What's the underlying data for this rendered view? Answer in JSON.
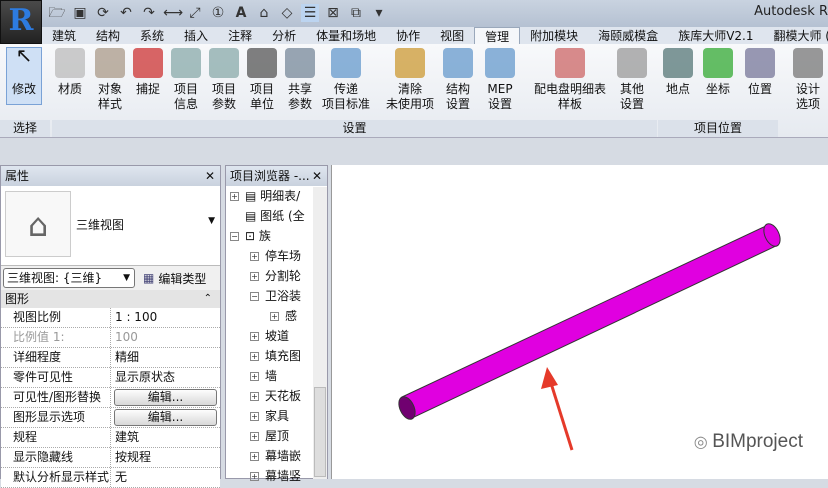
{
  "app": {
    "title": "Autodesk R",
    "logo": "R"
  },
  "quick_access": [
    "open-icon",
    "save-icon",
    "sync-icon",
    "undo-icon",
    "redo-icon",
    "measure-icon",
    "dimension-icon",
    "tag-icon",
    "text-icon",
    "3d-view-icon",
    "section-icon",
    "thin-lines-icon",
    "close-views-icon",
    "switch-windows-icon",
    "customize-icon"
  ],
  "tabs": [
    "建筑",
    "结构",
    "系统",
    "插入",
    "注释",
    "分析",
    "体量和场地",
    "协作",
    "视图",
    "管理",
    "附加模块",
    "海颐威模盒",
    "族库大师V2.1",
    "翻模大师 ("
  ],
  "active_tab": "管理",
  "ribbon": {
    "buttons": [
      {
        "label": "修改",
        "icon": "cursor-icon"
      },
      {
        "label": "材质",
        "icon": "material-icon"
      },
      {
        "label": "对象\n样式",
        "icon": "object-styles-icon"
      },
      {
        "label": "捕捉",
        "icon": "snap-magnet-icon"
      },
      {
        "label": "项目\n信息",
        "icon": "project-info-icon"
      },
      {
        "label": "项目\n参数",
        "icon": "project-params-icon"
      },
      {
        "label": "项目\n单位",
        "icon": "project-units-icon"
      },
      {
        "label": "共享\n参数",
        "icon": "shared-params-icon"
      },
      {
        "label": "传递\n项目标准",
        "icon": "transfer-standards-icon"
      },
      {
        "label": "清除\n未使用项",
        "icon": "purge-icon"
      },
      {
        "label": "结构\n设置",
        "icon": "structural-settings-icon"
      },
      {
        "label": "MEP\n设置",
        "icon": "mep-settings-icon"
      },
      {
        "label": "配电盘明细表\n样板",
        "icon": "panel-schedule-icon"
      },
      {
        "label": "其他\n设置",
        "icon": "wrench-icon"
      },
      {
        "label": "地点",
        "icon": "globe-icon"
      },
      {
        "label": "坐标",
        "icon": "axes-icon"
      },
      {
        "label": "位置",
        "icon": "position-icon"
      },
      {
        "label": "设计\n选项",
        "icon": "design-options-icon"
      }
    ],
    "panels": [
      "选择",
      "设置",
      "项目位置"
    ]
  },
  "properties": {
    "title": "属性",
    "type_name": "三维视图",
    "selector": "三维视图: {三维}",
    "edit_type": "编辑类型",
    "group": "图形",
    "rows": [
      {
        "k": "视图比例",
        "v": "1 : 100"
      },
      {
        "k": "比例值 1:",
        "v": "100",
        "disabled": true
      },
      {
        "k": "详细程度",
        "v": "精细"
      },
      {
        "k": "零件可见性",
        "v": "显示原状态"
      },
      {
        "k": "可见性/图形替换",
        "v": "编辑...",
        "button": true
      },
      {
        "k": "图形显示选项",
        "v": "编辑...",
        "button": true
      },
      {
        "k": "规程",
        "v": "建筑"
      },
      {
        "k": "显示隐藏线",
        "v": "按规程"
      },
      {
        "k": "默认分析显示样式",
        "v": "无"
      }
    ]
  },
  "browser": {
    "title": "项目浏览器 -...",
    "items": [
      {
        "t": "明细表/",
        "lvl": 0,
        "pm": "+"
      },
      {
        "t": "图纸 (全",
        "lvl": 0,
        "pm": ""
      },
      {
        "t": "族",
        "lvl": 0,
        "pm": "-"
      },
      {
        "t": "停车场",
        "lvl": 1,
        "pm": "+"
      },
      {
        "t": "分割轮",
        "lvl": 1,
        "pm": "+"
      },
      {
        "t": "卫浴装",
        "lvl": 1,
        "pm": "-"
      },
      {
        "t": "感",
        "lvl": 2,
        "pm": "+"
      },
      {
        "t": "坡道",
        "lvl": 1,
        "pm": "+"
      },
      {
        "t": "填充图",
        "lvl": 1,
        "pm": "+"
      },
      {
        "t": "墙",
        "lvl": 1,
        "pm": "+"
      },
      {
        "t": "天花板",
        "lvl": 1,
        "pm": "+"
      },
      {
        "t": "家具",
        "lvl": 1,
        "pm": "+"
      },
      {
        "t": "屋顶",
        "lvl": 1,
        "pm": "+"
      },
      {
        "t": "幕墙嵌",
        "lvl": 1,
        "pm": "+"
      },
      {
        "t": "幕墙竖",
        "lvl": 1,
        "pm": "+"
      }
    ]
  },
  "canvas": {
    "watermark": "BIMproject",
    "pipe_color": "#e000e0",
    "arrow_color": "#e53a2a"
  }
}
